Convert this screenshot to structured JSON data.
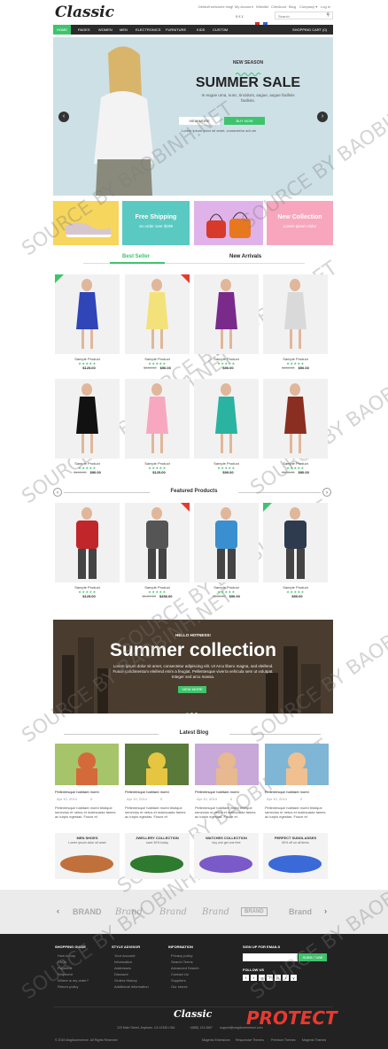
{
  "header": {
    "logo": "Classic",
    "top_left_link": "Default welcome msg!",
    "links": [
      "My Account",
      "Wishlist",
      "Checkout",
      "Blog",
      "Company ▾",
      "Log in"
    ],
    "currency": "$ € £",
    "search_placeholder": "Search"
  },
  "nav": {
    "items": [
      "HOME",
      "PAGES",
      "WOMEN",
      "MEN",
      "ELECTRONICS",
      "FURNITURE",
      "KIDS",
      "CUSTOM"
    ],
    "cart": "SHOPPING CART (0)"
  },
  "hero": {
    "eyebrow": "NEW SEASON",
    "title": "SUMMER SALE",
    "desc": "In eugue urna, nunc, tincidunt, augue, augue facilisis facilisis.",
    "btn_view": "VIEW MORE",
    "btn_buy": "BUY NOW",
    "note": "Lorem ipsum dolor sit amet, consectetur adi ctn"
  },
  "banners": {
    "free_shipping": "Free Shipping",
    "free_sub": "on order over $199",
    "new_collection": "New Collection",
    "new_sub": "Lorem ipsum dolor"
  },
  "tabs": [
    "Best Seller",
    "New Arrivals"
  ],
  "products_row1": [
    {
      "name": "Sample Product",
      "price": "$125.00",
      "old": ""
    },
    {
      "name": "Sample Product",
      "price": "$90.00",
      "old": "$100.00"
    },
    {
      "name": "Sample Product",
      "price": "$90.00",
      "old": ""
    },
    {
      "name": "Sample Product",
      "price": "$90.00",
      "old": "$100.00"
    }
  ],
  "products_row2": [
    {
      "name": "Sample Product",
      "price": "$90.00",
      "old": "$100.00"
    },
    {
      "name": "Sample Product",
      "price": "$125.00",
      "old": ""
    },
    {
      "name": "Sample Product",
      "price": "$90.00",
      "old": ""
    },
    {
      "name": "Sample Product",
      "price": "$90.00",
      "old": "$100.00"
    }
  ],
  "featured": {
    "title": "Featured Products",
    "items": [
      {
        "name": "Sample Product",
        "price": "$125.00",
        "old": ""
      },
      {
        "name": "Sample Product",
        "price": "$456.00",
        "old": "$1,00.00"
      },
      {
        "name": "Sample Product",
        "price": "$90.00",
        "old": "$100.00"
      },
      {
        "name": "Sample Product",
        "price": "$90.00",
        "old": ""
      }
    ]
  },
  "summer": {
    "eyebrow": "HELLO HOTNESS!",
    "title": "Summer collection",
    "text": "Lorem ipsum dolor sit amet, consectetur adipiscing elit. Ut Arcu libero magna, sed eleifend. Fusce condimentum eleifend enim a feugiat. Pellentesque viverra vehicula sem ut volutpat. Integer sed arcu massa.",
    "btn": "VIEW MORE"
  },
  "blog": {
    "title": "Latest Blog",
    "post_title": "Pellentesque habitant morbi",
    "date": "Apr 10, 2014",
    "comments": "0",
    "excerpt": "Pellentesque habitant morbi tristique senectus et netus et malesuada fames ac turpis egestas. Fusce et"
  },
  "promos": [
    {
      "title": "MEN SHOES",
      "sub": "Lorem ipsum dolor sit amet"
    },
    {
      "title": "JWELLERY COLLECTION",
      "sub": "save 30% today"
    },
    {
      "title": "WATCHES COLLECTION",
      "sub": "buy one get one free"
    },
    {
      "title": "PERFECT SUNGLASSES",
      "sub": "50% off on all items"
    }
  ],
  "brands": [
    "BRAND",
    "Brand",
    "Brand",
    "Brand",
    "BRAND",
    "Brand"
  ],
  "footer": {
    "col1_title": "SHOPPING GUIDE",
    "col1": [
      "How to buy",
      "FAQs",
      "Payment",
      "Shipment",
      "Where is my order?",
      "Return policy"
    ],
    "col2_title": "STYLE ADVISOR",
    "col2": [
      "Your Account",
      "Information",
      "Addresses",
      "Discount",
      "Orders History",
      "Additional Information"
    ],
    "col3_title": "INFORMATION",
    "col3": [
      "Privacy policy",
      "Search Terms",
      "Advanced Search",
      "Contact Us",
      "Suppliers",
      "Our stores"
    ],
    "signup_title": "SIGN UP FOR EMAILS",
    "subscribe": "SUBSCRIBE",
    "follow": "FOLLOW US",
    "logo": "Classic",
    "address": "123 Main Street, Anytown, CA 12345 USA",
    "phone": "+(888) 123-4567",
    "email": "support@magikcommerce.com",
    "copyright": "© 2015 Magikcommerce. All Rights Reserved",
    "bottom_links": [
      "Magento Extensions",
      "Responsive Themes",
      "Premium Themes",
      "Magento Themes"
    ]
  },
  "watermark": "SOURCE BY BAOBINH.NET",
  "protect_logo": "PROTECT",
  "colors": {
    "accent": "#3ec46d",
    "pink": "#f7a6bd",
    "yellow": "#f6d65c",
    "teal": "#5ac9c2",
    "lavender": "#e0b2ea",
    "dark": "#2b2b2b"
  }
}
